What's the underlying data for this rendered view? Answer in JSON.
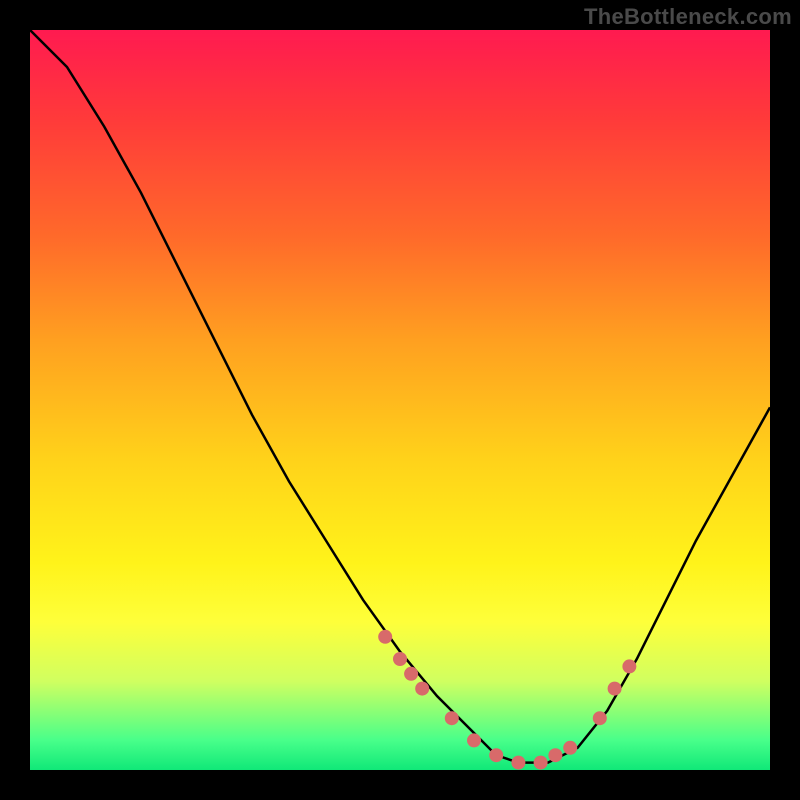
{
  "watermark": "TheBottleneck.com",
  "colors": {
    "background": "#000000",
    "curve_stroke": "#000000",
    "dot_fill": "#d86a6a",
    "gradient_top": "#ff1a50",
    "gradient_bottom": "#10e878"
  },
  "chart_data": {
    "type": "line",
    "title": "",
    "xlabel": "",
    "ylabel": "",
    "xlim": [
      0,
      100
    ],
    "ylim": [
      0,
      100
    ],
    "gradient_axis": "y",
    "series": [
      {
        "name": "curve",
        "x": [
          0,
          5,
          10,
          15,
          20,
          25,
          30,
          35,
          40,
          45,
          50,
          55,
          60,
          63,
          66,
          70,
          74,
          78,
          82,
          86,
          90,
          95,
          100
        ],
        "values": [
          100,
          95,
          87,
          78,
          68,
          58,
          48,
          39,
          31,
          23,
          16,
          10,
          5,
          2,
          1,
          1,
          3,
          8,
          15,
          23,
          31,
          40,
          49
        ]
      }
    ],
    "dots": {
      "name": "highlight-points",
      "x": [
        48,
        50,
        51.5,
        53,
        57,
        60,
        63,
        66,
        69,
        71,
        73,
        77,
        79,
        81
      ],
      "values": [
        18,
        15,
        13,
        11,
        7,
        4,
        2,
        1,
        1,
        2,
        3,
        7,
        11,
        14
      ]
    }
  }
}
